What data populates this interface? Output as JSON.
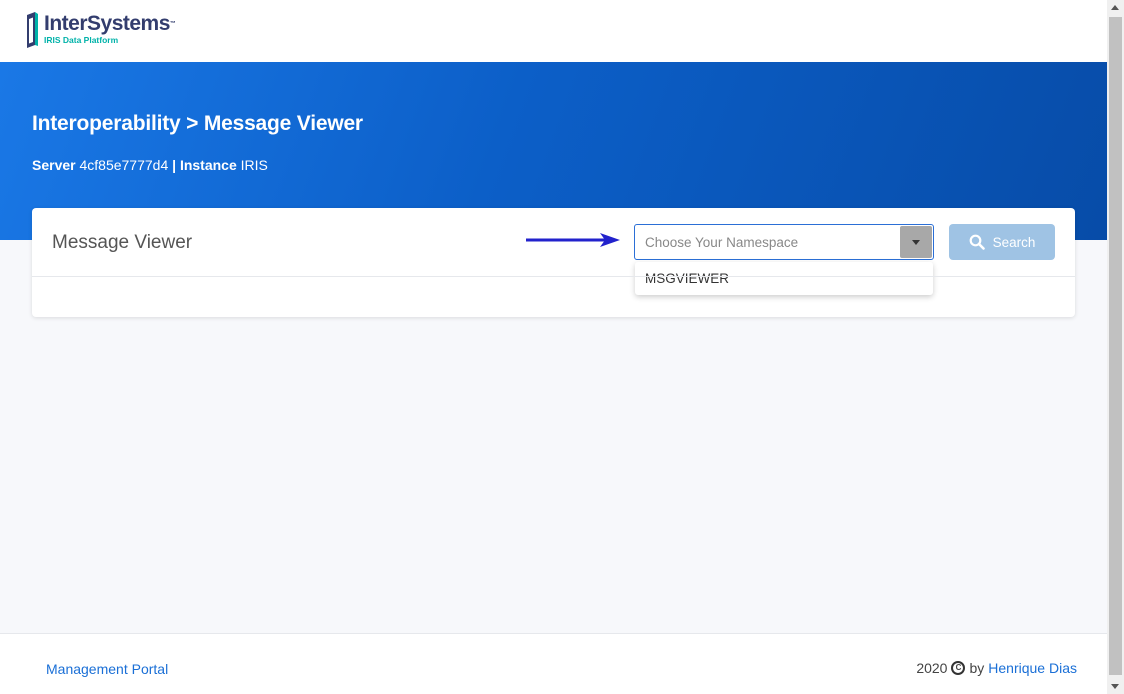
{
  "logo": {
    "name": "InterSystems",
    "tm": "™",
    "subtitle": "IRIS Data Platform",
    "icon": "intersystems-logo-icon"
  },
  "banner": {
    "title": "Interoperability > Message Viewer",
    "server_label": "Server",
    "server_value": "4cf85e7777d4",
    "separator": "|",
    "instance_label": "Instance",
    "instance_value": "IRIS"
  },
  "card": {
    "title": "Message Viewer",
    "namespace_select": {
      "placeholder": "Choose Your Namespace",
      "options": [
        "MSGVIEWER"
      ]
    },
    "search_button": {
      "label": "Search",
      "icon": "search-icon"
    }
  },
  "footer": {
    "left_link": "Management Portal",
    "year": "2020",
    "copyright_symbol": "C",
    "by": "by",
    "author": "Henrique Dias"
  },
  "colors": {
    "brand_blue": "#0c5fc8",
    "link_blue": "#1a6fd6",
    "button_disabled": "#9fc3e4",
    "teal": "#00b2a9",
    "arrow": "#2222cc"
  }
}
